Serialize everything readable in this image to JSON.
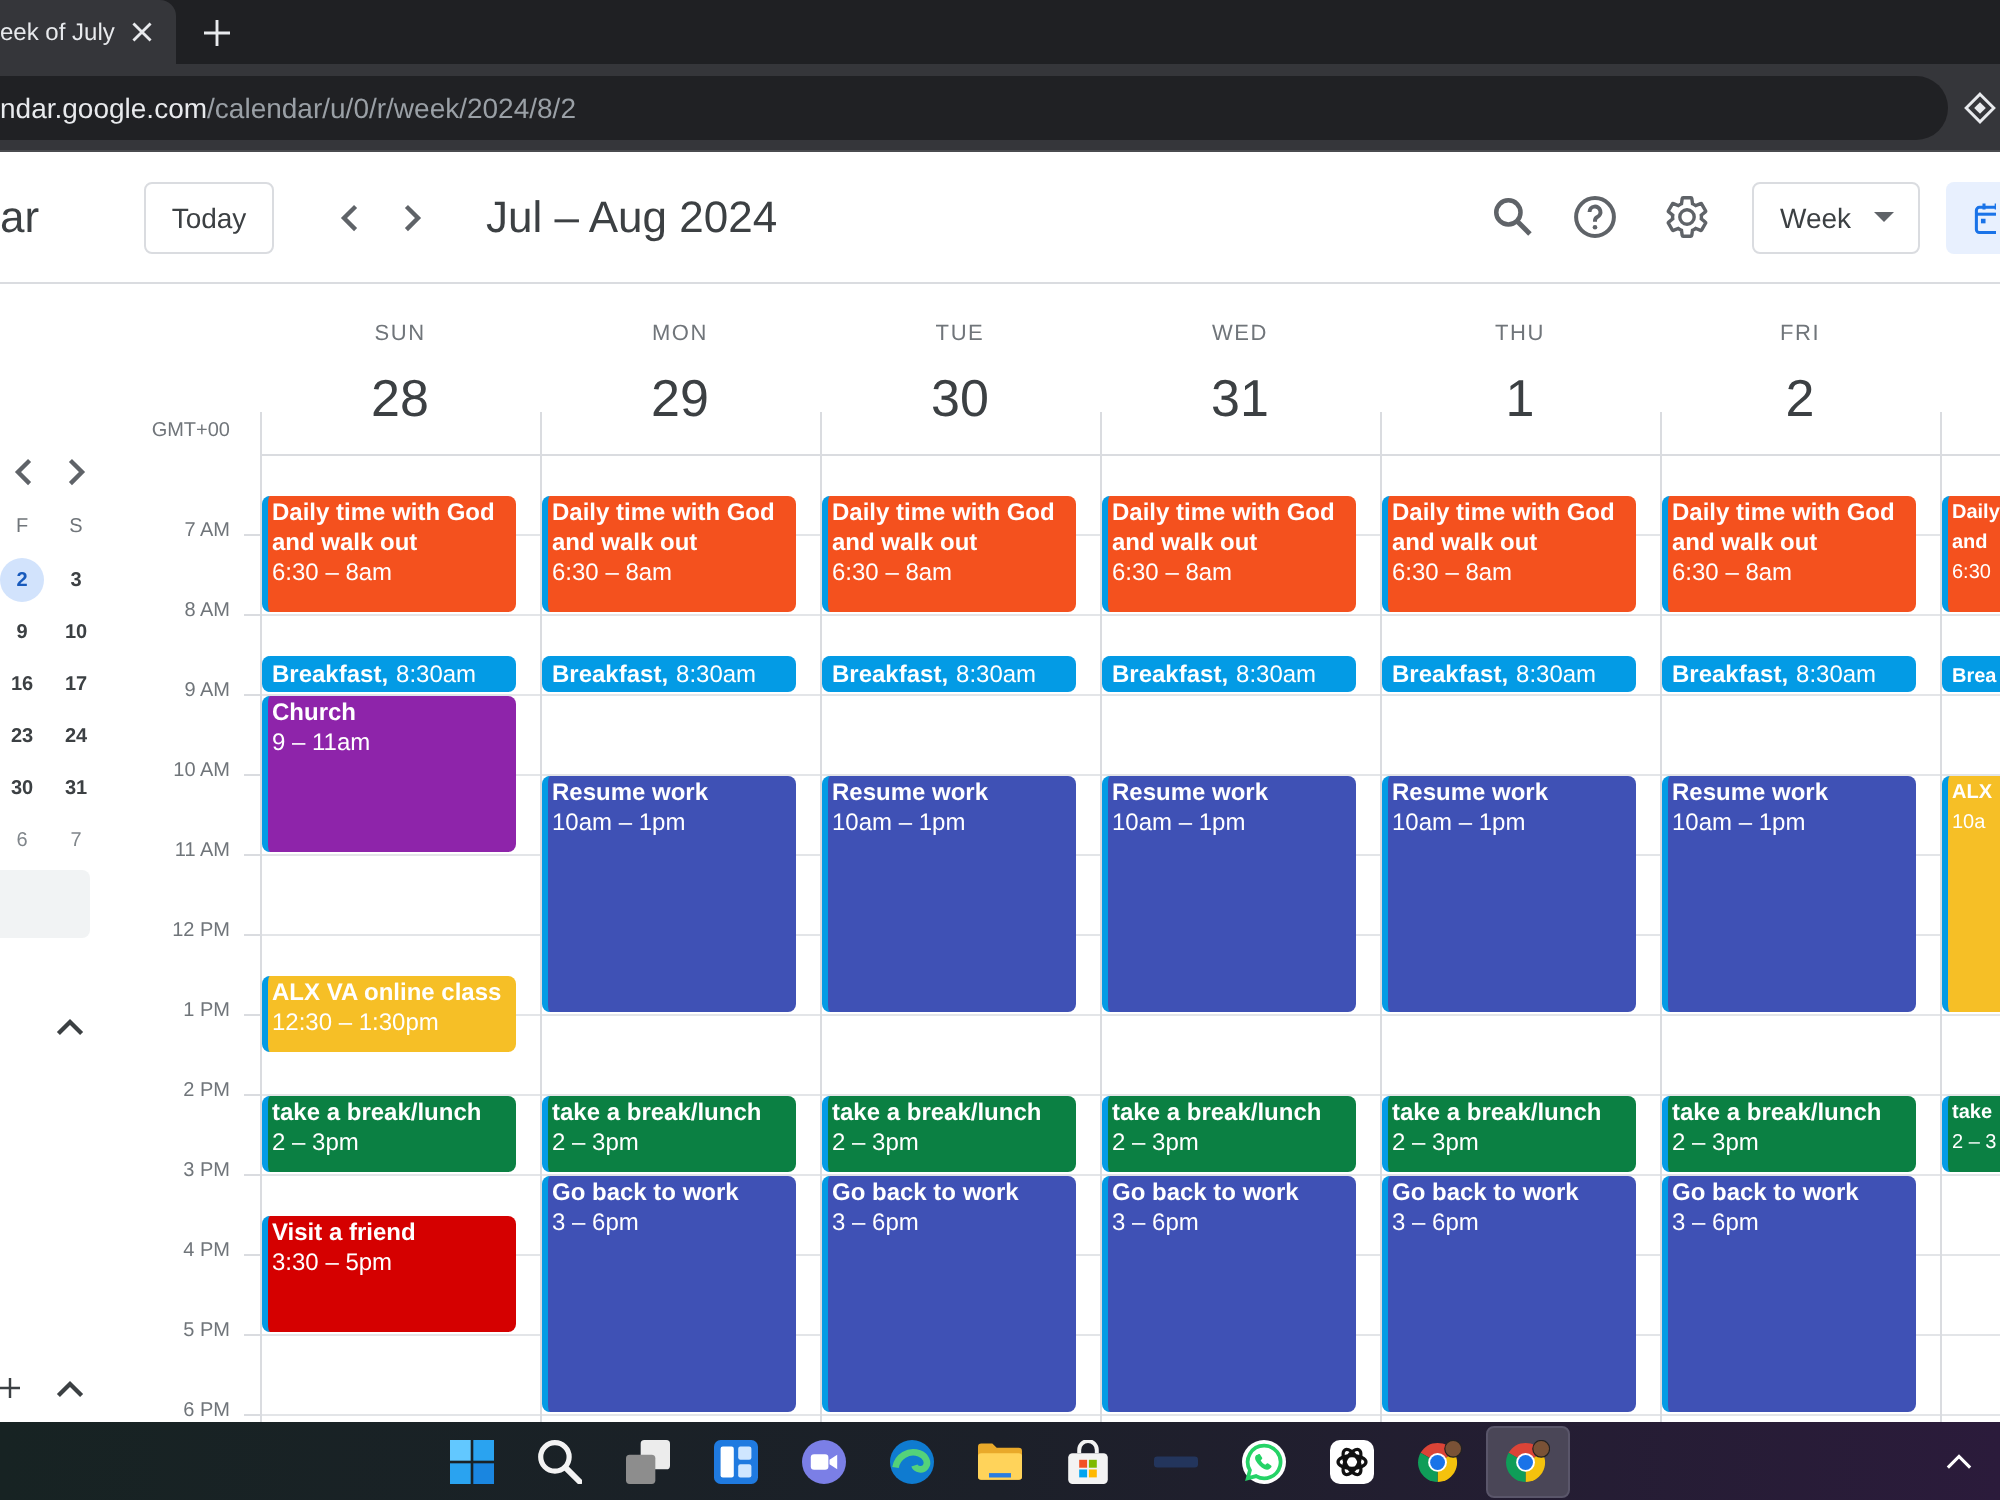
{
  "browser": {
    "tab_title": "eek of July",
    "url_host": "ndar.google.com",
    "url_path": "/calendar/u/0/r/week/2024/8/2"
  },
  "header": {
    "app_name": "ar",
    "today_button": "Today",
    "date_range": "Jul – Aug 2024",
    "view_select": "Week"
  },
  "sidebar": {
    "mini_calendar": {
      "weekdays": [
        "F",
        "S"
      ],
      "weeks": [
        [
          {
            "day": "2",
            "selected": true,
            "other_month": false
          },
          {
            "day": "3",
            "selected": false,
            "other_month": false
          }
        ],
        [
          {
            "day": "9",
            "selected": false,
            "other_month": false
          },
          {
            "day": "10",
            "selected": false,
            "other_month": false
          }
        ],
        [
          {
            "day": "16",
            "selected": false,
            "other_month": false
          },
          {
            "day": "17",
            "selected": false,
            "other_month": false
          }
        ],
        [
          {
            "day": "23",
            "selected": false,
            "other_month": false
          },
          {
            "day": "24",
            "selected": false,
            "other_month": false
          }
        ],
        [
          {
            "day": "30",
            "selected": false,
            "other_month": false
          },
          {
            "day": "31",
            "selected": false,
            "other_month": false
          }
        ],
        [
          {
            "day": "6",
            "selected": false,
            "other_month": true
          },
          {
            "day": "7",
            "selected": false,
            "other_month": true
          }
        ]
      ]
    }
  },
  "timezone": "GMT+00",
  "hours": [
    "7 AM",
    "8 AM",
    "9 AM",
    "10 AM",
    "11 AM",
    "12 PM",
    "1 PM",
    "2 PM",
    "3 PM",
    "4 PM",
    "5 PM",
    "6 PM"
  ],
  "days": [
    {
      "name": "SUN",
      "number": "28",
      "events": [
        {
          "kind": "block",
          "title": "Daily time with God and walk out",
          "time": "6:30 – 8am",
          "color": "#f4511e"
        },
        {
          "kind": "inline",
          "title": "Breakfast,",
          "time": "8:30am",
          "color": "#039be5"
        },
        {
          "kind": "block",
          "title": "Church",
          "time": "9 – 11am",
          "color": "#8e24aa"
        },
        {
          "kind": "block",
          "title": "ALX VA online class",
          "time": "12:30 – 1:30pm",
          "color": "#f6bf26"
        },
        {
          "kind": "block",
          "title": "take a break/lunch",
          "time": "2 – 3pm",
          "color": "#0b8043"
        },
        {
          "kind": "block",
          "title": "Visit a friend",
          "time": "3:30 – 5pm",
          "color": "#d50000"
        }
      ]
    },
    {
      "name": "MON",
      "number": "29",
      "events": [
        {
          "kind": "block",
          "title": "Daily time with God and walk out",
          "time": "6:30 – 8am",
          "color": "#f4511e"
        },
        {
          "kind": "inline",
          "title": "Breakfast,",
          "time": "8:30am",
          "color": "#039be5"
        },
        {
          "kind": "block",
          "title": "Resume work",
          "time": "10am – 1pm",
          "color": "#3f51b5"
        },
        {
          "kind": "block",
          "title": "take a break/lunch",
          "time": "2 – 3pm",
          "color": "#0b8043"
        },
        {
          "kind": "block",
          "title": "Go back to work",
          "time": "3 – 6pm",
          "color": "#3f51b5"
        }
      ]
    },
    {
      "name": "TUE",
      "number": "30",
      "events": [
        {
          "kind": "block",
          "title": "Daily time with God and walk out",
          "time": "6:30 – 8am",
          "color": "#f4511e"
        },
        {
          "kind": "inline",
          "title": "Breakfast,",
          "time": "8:30am",
          "color": "#039be5"
        },
        {
          "kind": "block",
          "title": "Resume work",
          "time": "10am – 1pm",
          "color": "#3f51b5"
        },
        {
          "kind": "block",
          "title": "take a break/lunch",
          "time": "2 – 3pm",
          "color": "#0b8043"
        },
        {
          "kind": "block",
          "title": "Go back to work",
          "time": "3 – 6pm",
          "color": "#3f51b5"
        }
      ]
    },
    {
      "name": "WED",
      "number": "31",
      "events": [
        {
          "kind": "block",
          "title": "Daily time with God and walk out",
          "time": "6:30 – 8am",
          "color": "#f4511e"
        },
        {
          "kind": "inline",
          "title": "Breakfast,",
          "time": "8:30am",
          "color": "#039be5"
        },
        {
          "kind": "block",
          "title": "Resume work",
          "time": "10am – 1pm",
          "color": "#3f51b5"
        },
        {
          "kind": "block",
          "title": "take a break/lunch",
          "time": "2 – 3pm",
          "color": "#0b8043"
        },
        {
          "kind": "block",
          "title": "Go back to work",
          "time": "3 – 6pm",
          "color": "#3f51b5"
        }
      ]
    },
    {
      "name": "THU",
      "number": "1",
      "events": [
        {
          "kind": "block",
          "title": "Daily time with God and walk out",
          "time": "6:30 – 8am",
          "color": "#f4511e"
        },
        {
          "kind": "inline",
          "title": "Breakfast,",
          "time": "8:30am",
          "color": "#039be5"
        },
        {
          "kind": "block",
          "title": "Resume work",
          "time": "10am – 1pm",
          "color": "#3f51b5"
        },
        {
          "kind": "block",
          "title": "take a break/lunch",
          "time": "2 – 3pm",
          "color": "#0b8043"
        },
        {
          "kind": "block",
          "title": "Go back to work",
          "time": "3 – 6pm",
          "color": "#3f51b5"
        }
      ]
    },
    {
      "name": "FRI",
      "number": "2",
      "events": [
        {
          "kind": "block",
          "title": "Daily time with God and walk out",
          "time": "6:30 – 8am",
          "color": "#f4511e"
        },
        {
          "kind": "inline",
          "title": "Breakfast,",
          "time": "8:30am",
          "color": "#039be5"
        },
        {
          "kind": "block",
          "title": "Resume work",
          "time": "10am – 1pm",
          "color": "#3f51b5"
        },
        {
          "kind": "block",
          "title": "take a break/lunch",
          "time": "2 – 3pm",
          "color": "#0b8043"
        },
        {
          "kind": "block",
          "title": "Go back to work",
          "time": "3 – 6pm",
          "color": "#3f51b5"
        }
      ]
    }
  ],
  "next_day_events": [
    {
      "kind": "block",
      "title": "Daily and",
      "time": "6:30",
      "color": "#f4511e"
    },
    {
      "kind": "inline",
      "title": "Brea",
      "color": "#039be5"
    },
    {
      "kind": "block",
      "title": "ALX",
      "time": "10a",
      "color": "#f6bf26"
    },
    {
      "kind": "block",
      "title": "take",
      "time": "2 – 3",
      "color": "#0b8043"
    }
  ],
  "taskbar": {
    "apps": [
      {
        "kind": "start",
        "active": false
      },
      {
        "kind": "search",
        "active": false
      },
      {
        "kind": "task_view",
        "active": false
      },
      {
        "kind": "widgets",
        "active": false
      },
      {
        "kind": "video_chat",
        "active": false
      },
      {
        "kind": "edge",
        "active": false
      },
      {
        "kind": "folder",
        "active": false
      },
      {
        "kind": "store",
        "active": false
      },
      {
        "kind": "dash",
        "active": false
      },
      {
        "kind": "phone_chat",
        "active": false
      },
      {
        "kind": "knot",
        "active": false
      },
      {
        "kind": "chrome",
        "active": false
      },
      {
        "kind": "chrome",
        "active": true
      }
    ]
  }
}
